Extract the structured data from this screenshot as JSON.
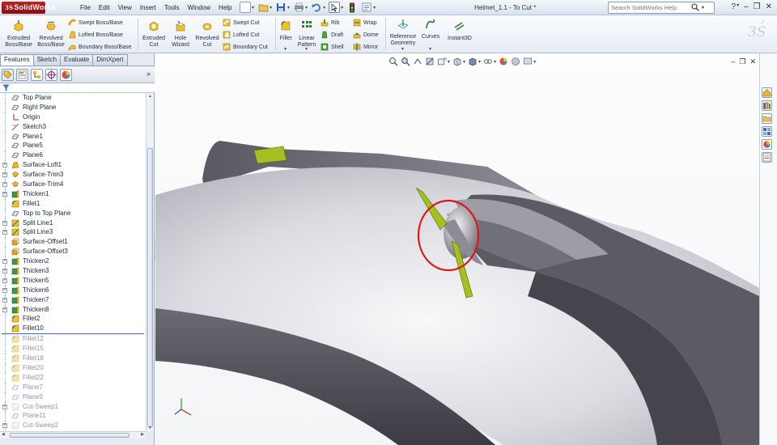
{
  "app": {
    "brand": "SolidWorks",
    "doc_title": "Helmet_1.1 - To Cut *"
  },
  "menu": [
    "File",
    "Edit",
    "View",
    "Insert",
    "Tools",
    "Window",
    "Help"
  ],
  "search": {
    "placeholder": "Search SolidWorks Help"
  },
  "ribbon": {
    "extruded_boss": "Extruded Boss/Base",
    "revolved_boss": "Revolved Boss/Base",
    "swept_boss": "Swept Boss/Base",
    "lofted_boss": "Lofted Boss/Base",
    "boundary_boss": "Boundary Boss/Base",
    "extruded_cut": "Extruded Cut",
    "hole_wizard": "Hole Wizard",
    "revolved_cut": "Revolved Cut",
    "swept_cut": "Swept Cut",
    "lofted_cut": "Lofted Cut",
    "boundary_cut": "Boundary Cut",
    "fillet": "Fillet",
    "linear_pattern": "Linear Pattern",
    "rib": "Rib",
    "draft": "Draft",
    "shell": "Shell",
    "wrap": "Wrap",
    "dome": "Dome",
    "mirror": "Mirror",
    "reference_geometry": "Reference Geometry",
    "curves": "Curves",
    "instant3d": "Instant3D"
  },
  "tabs": [
    "Features",
    "Sketch",
    "Evaluate",
    "DimXpert"
  ],
  "tree": [
    {
      "label": "Top Plane",
      "icon": "plane-icon",
      "expand": false,
      "suppressed": false
    },
    {
      "label": "Right Plane",
      "icon": "plane-icon",
      "expand": false,
      "suppressed": false
    },
    {
      "label": "Origin",
      "icon": "origin-icon",
      "expand": false,
      "suppressed": false
    },
    {
      "label": "Sketch3",
      "icon": "sketch-icon",
      "expand": false,
      "suppressed": false
    },
    {
      "label": "Plane1",
      "icon": "plane-icon",
      "expand": false,
      "suppressed": false
    },
    {
      "label": "Plane5",
      "icon": "plane-icon",
      "expand": false,
      "suppressed": false
    },
    {
      "label": "Plane6",
      "icon": "plane-icon",
      "expand": false,
      "suppressed": false
    },
    {
      "label": "Surface-Loft1",
      "icon": "surface-loft-icon",
      "expand": true,
      "suppressed": false
    },
    {
      "label": "Surface-Trim3",
      "icon": "surface-trim-icon",
      "expand": true,
      "suppressed": false
    },
    {
      "label": "Surface-Trim4",
      "icon": "surface-trim-icon",
      "expand": true,
      "suppressed": false
    },
    {
      "label": "Thicken1",
      "icon": "thicken-icon",
      "expand": true,
      "suppressed": false
    },
    {
      "label": "Fillet1",
      "icon": "fillet-icon",
      "expand": false,
      "suppressed": false
    },
    {
      "label": "Top to Top Plane",
      "icon": "plane-icon",
      "expand": false,
      "suppressed": false
    },
    {
      "label": "Split Line1",
      "icon": "split-line-icon",
      "expand": true,
      "suppressed": false
    },
    {
      "label": "Split Line3",
      "icon": "split-line-icon",
      "expand": true,
      "suppressed": false
    },
    {
      "label": "Surface-Offset1",
      "icon": "surface-offset-icon",
      "expand": false,
      "suppressed": false
    },
    {
      "label": "Surface-Offset3",
      "icon": "surface-offset-icon",
      "expand": false,
      "suppressed": false
    },
    {
      "label": "Thicken2",
      "icon": "thicken-icon",
      "expand": true,
      "suppressed": false
    },
    {
      "label": "Thicken3",
      "icon": "thicken-icon",
      "expand": true,
      "suppressed": false
    },
    {
      "label": "Thicken5",
      "icon": "thicken-icon",
      "expand": true,
      "suppressed": false
    },
    {
      "label": "Thicken6",
      "icon": "thicken-icon",
      "expand": true,
      "suppressed": false
    },
    {
      "label": "Thicken7",
      "icon": "thicken-icon",
      "expand": true,
      "suppressed": false
    },
    {
      "label": "Thicken8",
      "icon": "thicken-icon",
      "expand": true,
      "suppressed": false
    },
    {
      "label": "Fillet2",
      "icon": "fillet-icon",
      "expand": false,
      "suppressed": false
    },
    {
      "label": "Fillet10",
      "icon": "fillet-icon",
      "expand": false,
      "suppressed": false
    },
    {
      "label": "Fillet12",
      "icon": "fillet-icon",
      "expand": false,
      "suppressed": true
    },
    {
      "label": "Fillet15",
      "icon": "fillet-icon",
      "expand": false,
      "suppressed": true
    },
    {
      "label": "Fillet18",
      "icon": "fillet-icon",
      "expand": false,
      "suppressed": true
    },
    {
      "label": "Fillet20",
      "icon": "fillet-icon",
      "expand": false,
      "suppressed": true
    },
    {
      "label": "Fillet22",
      "icon": "fillet-icon",
      "expand": false,
      "suppressed": true
    },
    {
      "label": "Plane7",
      "icon": "plane-icon",
      "expand": false,
      "suppressed": true
    },
    {
      "label": "Plane9",
      "icon": "plane-icon",
      "expand": false,
      "suppressed": true
    },
    {
      "label": "Cut-Sweep1",
      "icon": "cut-sweep-icon",
      "expand": true,
      "suppressed": true
    },
    {
      "label": "Plane11",
      "icon": "plane-icon",
      "expand": false,
      "suppressed": true
    },
    {
      "label": "Cut-Sweep2",
      "icon": "cut-sweep-icon",
      "expand": true,
      "suppressed": true
    }
  ],
  "colors": {
    "accent": "#3a6fc7",
    "brand_red": "#b01818",
    "model_face": "#d8d8dc",
    "model_dark": "#55545c",
    "highlight_face": "#a6c020",
    "annotation_circle": "#e01414"
  }
}
